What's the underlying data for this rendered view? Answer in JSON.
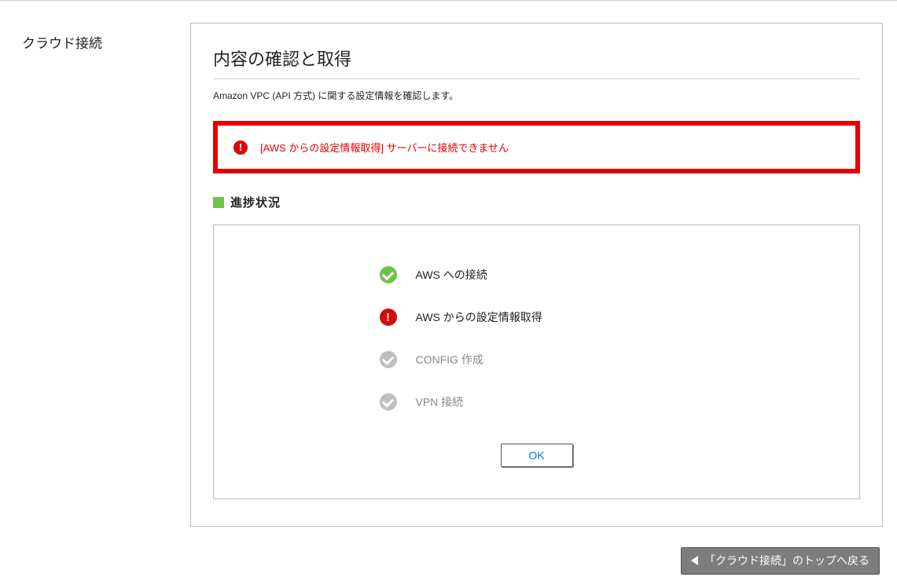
{
  "side": {
    "title": "クラウド接続"
  },
  "main": {
    "title": "内容の確認と取得",
    "subtitle": "Amazon VPC (API 方式) に関する設定情報を確認します。"
  },
  "alert": {
    "text": "[AWS からの設定情報取得] サーバーに接続できません"
  },
  "progress": {
    "heading": "進捗状況",
    "steps": [
      {
        "label": "AWS への接続",
        "state": "ok"
      },
      {
        "label": "AWS からの設定情報取得",
        "state": "error"
      },
      {
        "label": "CONFIG 作成",
        "state": "pending"
      },
      {
        "label": "VPN 接続",
        "state": "pending"
      }
    ],
    "ok_button": "OK"
  },
  "footer": {
    "back_label": "「クラウド接続」のトップへ戻る"
  }
}
